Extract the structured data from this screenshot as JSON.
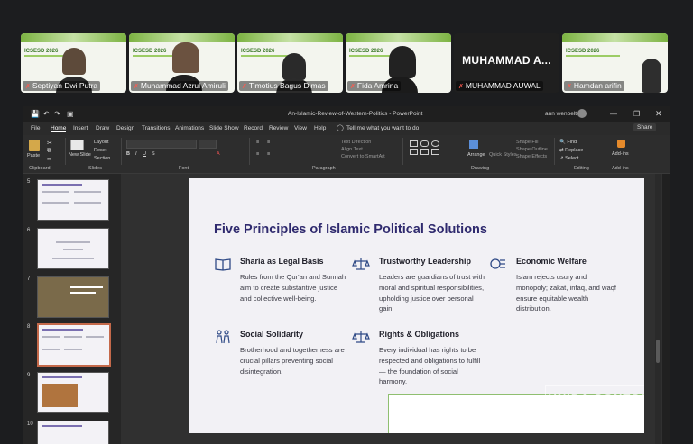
{
  "participants": [
    {
      "name": "Septiyan Dwi Putra",
      "event": "ICSESD 2026"
    },
    {
      "name": "Muhammad Azrul Amiruli",
      "event": "ICSESD 2026"
    },
    {
      "name": "Timotius Bagus Dimas",
      "event": "ICSESD 2026"
    },
    {
      "name": "Fida Amrina",
      "event": "ICSESD 2026"
    },
    {
      "name": "MUHAMMAD AUWAL",
      "display_name": "MUHAMMAD  A..."
    },
    {
      "name": "Hamdan arifin",
      "event": "ICSESD 2026"
    }
  ],
  "window": {
    "title": "An-Islamic-Review-of-Western-Politics  -  PowerPoint",
    "user": "ann wenbelt",
    "share_label": "Share"
  },
  "ribbon_tabs": [
    "File",
    "Home",
    "Insert",
    "Draw",
    "Design",
    "Transitions",
    "Animations",
    "Slide Show",
    "Record",
    "Review",
    "View",
    "Help"
  ],
  "tell_me": "Tell me what you want to do",
  "ribbon": {
    "clipboard": {
      "label": "Clipboard",
      "paste": "Paste"
    },
    "slides": {
      "label": "Slides",
      "new_slide": "New Slide",
      "layout": "Layout",
      "reset": "Reset",
      "section": "Section"
    },
    "font": {
      "label": "Font"
    },
    "paragraph": {
      "label": "Paragraph",
      "text_direction": "Text Direction",
      "align_text": "Align Text",
      "convert": "Convert to SmartArt"
    },
    "drawing": {
      "label": "Drawing",
      "arrange": "Arrange",
      "quick_styles": "Quick Styles",
      "shape_fill": "Shape Fill",
      "shape_outline": "Shape Outline",
      "shape_effects": "Shape Effects"
    },
    "editing": {
      "label": "Editing",
      "find": "Find",
      "replace": "Replace",
      "select": "Select"
    },
    "addins": {
      "label": "Add-ins",
      "button": "Add-ins"
    }
  },
  "slide_numbers": [
    "5",
    "6",
    "7",
    "8",
    "9",
    "10"
  ],
  "selected_slide": "8",
  "slide": {
    "title": "Five Principles of Islamic Political Solutions",
    "principles": [
      {
        "title": "Sharia as Legal Basis",
        "body": "Rules from the Qur'an and Sunnah aim to create substantive justice and collective well-being.",
        "icon": "book-icon"
      },
      {
        "title": "Trustworthy Leadership",
        "body": "Leaders are guardians of trust with moral and spiritual responsibilities, upholding justice over personal gain.",
        "icon": "scale-icon"
      },
      {
        "title": "Economic Welfare",
        "body": "Islam rejects usury and monopoly; zakat, infaq, and waqf ensure equitable wealth distribution.",
        "icon": "coins-icon"
      },
      {
        "title": "Social Solidarity",
        "body": "Brotherhood and togetherness are crucial pillars preventing social disintegration.",
        "icon": "people-icon"
      },
      {
        "title": "Rights & Obligations",
        "body": "Every individual has rights to be respected and obligations to fulfill — the foundation of social harmony.",
        "icon": "balance-icon"
      }
    ],
    "watermark": "UNIDA GONTOR"
  }
}
